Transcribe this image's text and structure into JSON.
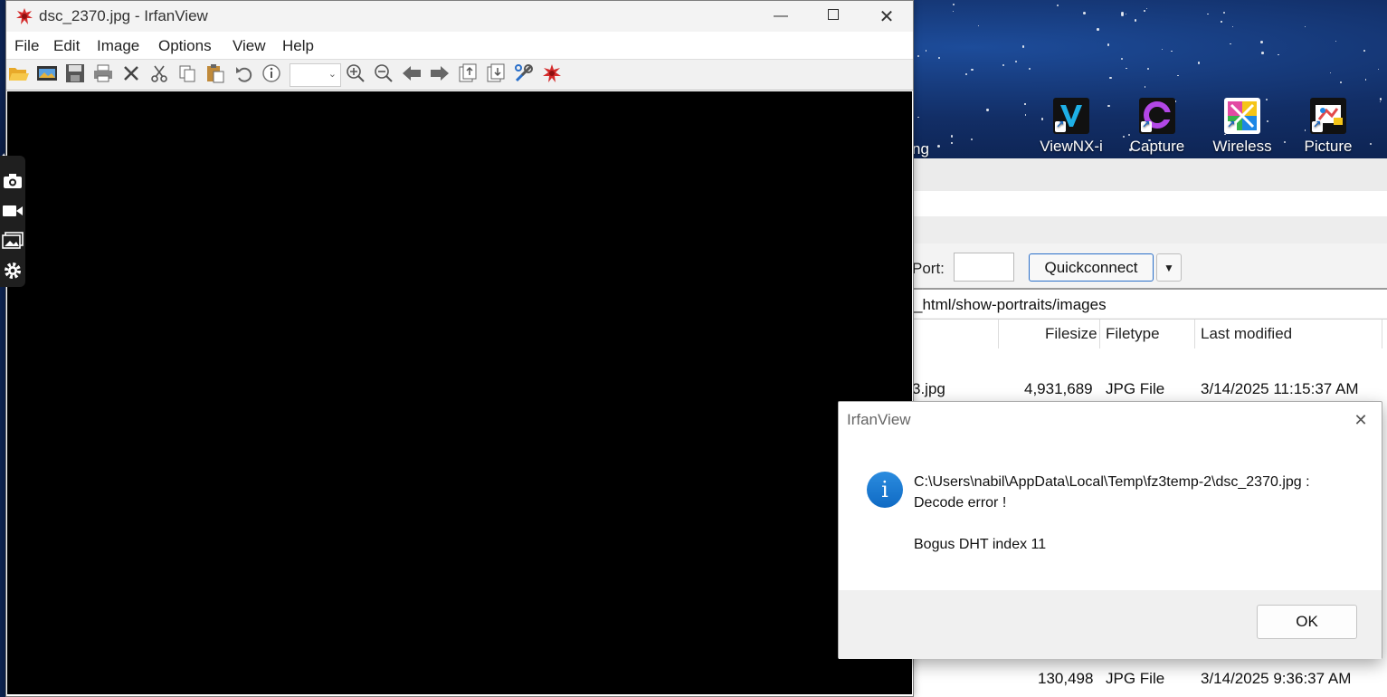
{
  "desktop": {
    "partial_label": "ng",
    "icons": [
      {
        "label": "ViewNX-i",
        "color": "#1eb0e6"
      },
      {
        "label": "Capture",
        "color": "#b347e6"
      },
      {
        "label": "Wireless",
        "color": "#e24aa3"
      },
      {
        "label": "Picture",
        "color": "#e6a81e"
      }
    ]
  },
  "filezilla": {
    "port_label": "Port:",
    "port_value": "",
    "quickconnect_label": "Quickconnect",
    "remote_path": "_html/show-portraits/images",
    "columns": {
      "filesize": "Filesize",
      "filetype": "Filetype",
      "last_modified": "Last modified"
    },
    "rows": [
      {
        "name": "3.jpg",
        "filesize": "4,931,689",
        "filetype": "JPG File",
        "modified": "3/14/2025 11:15:37 AM"
      },
      {
        "name": "",
        "filesize": "130,498",
        "filetype": "JPG File",
        "modified": "3/14/2025 9:36:37 AM"
      }
    ]
  },
  "irfanview": {
    "title": "dsc_2370.jpg - IrfanView",
    "menu": [
      "File",
      "Edit",
      "Image",
      "Options",
      "View",
      "Help"
    ],
    "zoom_value": "",
    "toolbar_icons": [
      "open-icon",
      "thumbnails-icon",
      "save-icon",
      "print-icon",
      "delete-icon",
      "cut-icon",
      "copy-icon",
      "paste-icon",
      "undo-icon",
      "info-icon",
      "zoom-in-icon",
      "zoom-out-icon",
      "prev-icon",
      "next-icon",
      "first-icon",
      "last-icon",
      "settings-icon",
      "irfanview-icon"
    ]
  },
  "dialog": {
    "title": "IrfanView",
    "message_line1": "C:\\Users\\nabil\\AppData\\Local\\Temp\\fz3temp-2\\dsc_2370.jpg :",
    "message_line2": "Decode error !",
    "message_line3": "Bogus DHT index 11",
    "ok_label": "OK"
  },
  "colors": {
    "accent": "#2a6fc9",
    "info_icon": "#1b7bd6"
  }
}
